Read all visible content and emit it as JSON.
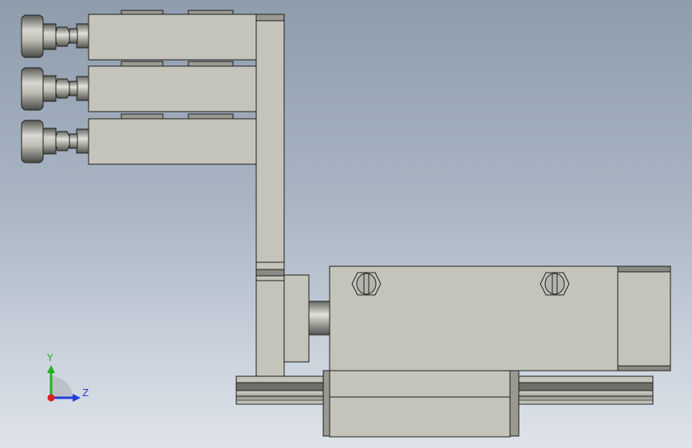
{
  "viewport": {
    "background_top": "#8f9cac",
    "background_bottom": "#dfe4ea"
  },
  "part_colors": {
    "body": "#c4c4bb",
    "shadow": "#6f6f6a",
    "outline": "#1e1e1e"
  },
  "triad": {
    "y_label": "Y",
    "z_label": "Z",
    "y_color": "#1fb21f",
    "z_color": "#1f3fd8",
    "x_color": "#d81f1f"
  }
}
